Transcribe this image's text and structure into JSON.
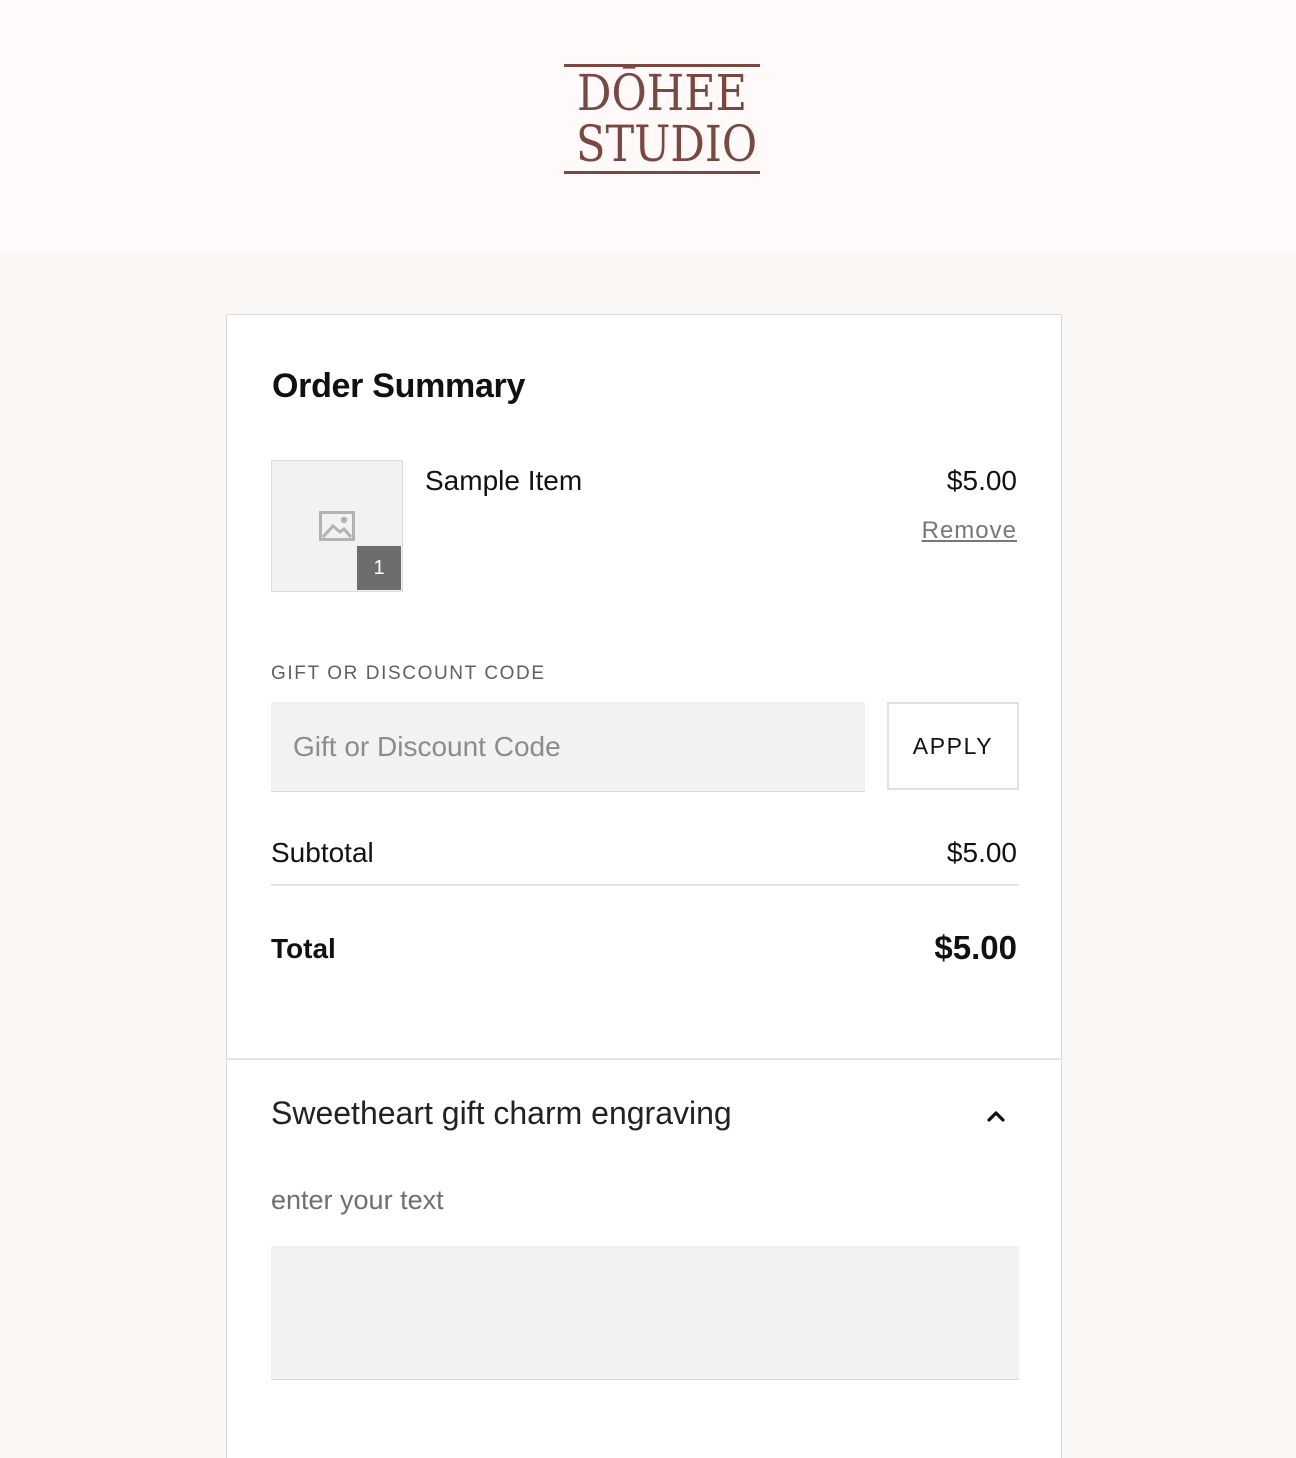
{
  "brand": {
    "logo_line1": "DŌHEE",
    "logo_line2": "STUDIO",
    "color": "#7a4741"
  },
  "order_summary": {
    "title": "Order Summary",
    "item": {
      "name": "Sample Item",
      "price": "$5.00",
      "quantity": "1",
      "remove_label": "Remove",
      "image_icon": "image-placeholder-icon"
    },
    "discount": {
      "label": "GIFT OR DISCOUNT CODE",
      "placeholder": "Gift or Discount Code",
      "value": "",
      "apply_label": "APPLY"
    },
    "subtotal_label": "Subtotal",
    "subtotal_value": "$5.00",
    "total_label": "Total",
    "total_value": "$5.00"
  },
  "engraving": {
    "title": "Sweetheart gift charm engraving",
    "expanded": true,
    "toggle_icon": "chevron-up-icon",
    "field_label": "enter your text",
    "field_value": ""
  }
}
